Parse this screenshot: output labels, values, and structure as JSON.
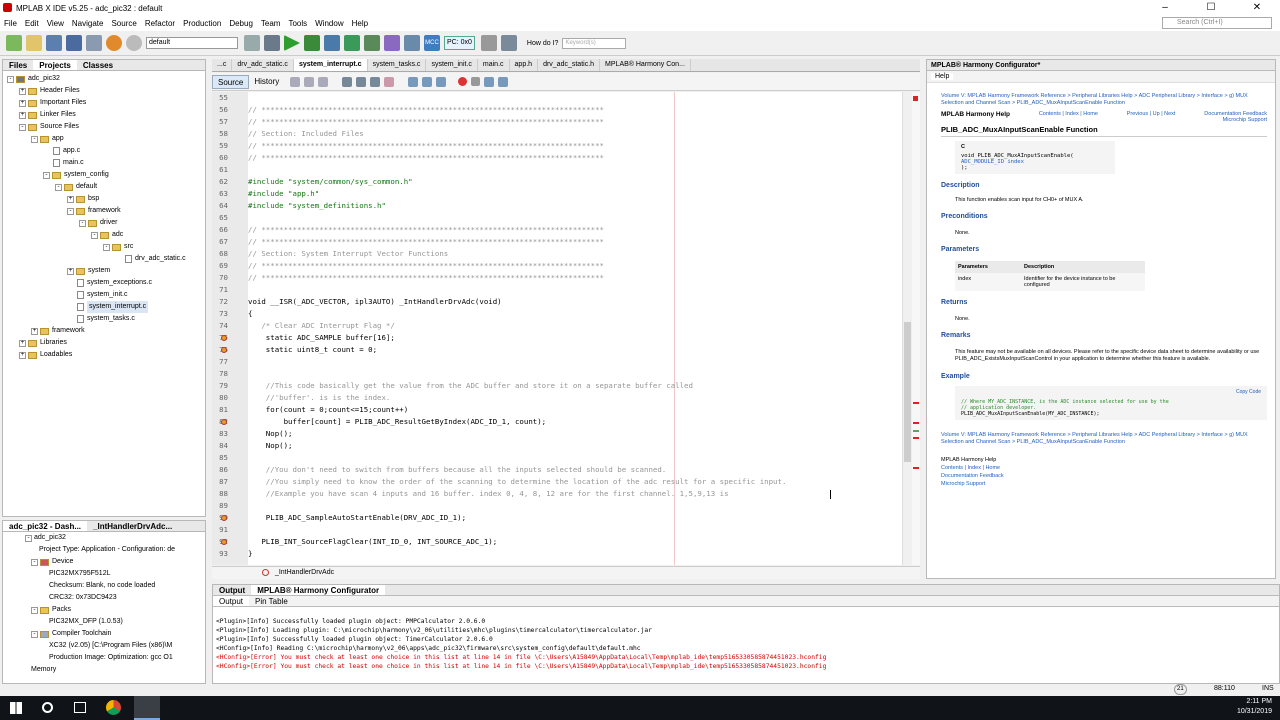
{
  "window": {
    "title": "MPLAB X IDE v5.25 - adc_pic32 : default",
    "minimize": "–",
    "maximize": "☐",
    "close": "✕"
  },
  "menu": [
    "File",
    "Edit",
    "View",
    "Navigate",
    "Source",
    "Refactor",
    "Production",
    "Debug",
    "Team",
    "Tools",
    "Window",
    "Help"
  ],
  "search_placeholder": "Search (Ctrl+I)",
  "toolbar": {
    "config": "default",
    "mcc": "MCC",
    "pc": "PC: 0x0",
    "how_do_i": "How do I?",
    "keywords": "Keyword(s)"
  },
  "projects_panel": {
    "tabs": [
      "Files",
      "Projects",
      "Classes"
    ],
    "items": [
      "adc_pic32",
      "Header Files",
      "Important Files",
      "Linker Files",
      "Source Files",
      "app",
      "app.c",
      "main.c",
      "system_config",
      "default",
      "bsp",
      "framework",
      "driver",
      "adc",
      "src",
      "drv_adc_static.c",
      "system",
      "system_exceptions.c",
      "system_init.c",
      "system_interrupt.c",
      "system_tasks.c",
      "framework",
      "Libraries",
      "Loadables"
    ]
  },
  "dashboard": {
    "tabs": [
      "adc_pic32 - Dash...",
      "_IntHandlerDrvAdc..."
    ],
    "items": [
      "adc_pic32",
      "Project Type: Application - Configuration: de",
      "Device",
      "PIC32MX795F512L",
      "Checksum: Blank, no code loaded",
      "CRC32: 0x73DC9423",
      "Packs",
      "PIC32MX_DFP (1.0.53)",
      "Compiler Toolchain",
      "XC32 (v2.05) [C:\\Program Files (x86)\\M",
      "Production Image: Optimization: gcc O1",
      "Memory"
    ]
  },
  "editor": {
    "tabs": [
      "...c",
      "drv_adc_static.c",
      "system_interrupt.c",
      "system_tasks.c",
      "system_init.c",
      "main.c",
      "app.h",
      "drv_adc_static.h",
      "MPLAB® Harmony Con..."
    ],
    "source_btn": "Source",
    "history_btn": "History",
    "lines": [
      {
        "n": "55",
        "t": ""
      },
      {
        "n": "56",
        "t": "// *****************************************************************************"
      },
      {
        "n": "57",
        "t": "// *****************************************************************************"
      },
      {
        "n": "58",
        "t": "// Section: Included Files"
      },
      {
        "n": "59",
        "t": "// *****************************************************************************"
      },
      {
        "n": "60",
        "t": "// *****************************************************************************"
      },
      {
        "n": "61",
        "t": ""
      },
      {
        "n": "62",
        "t": "#include \"system/common/sys_common.h\""
      },
      {
        "n": "63",
        "t": "#include \"app.h\""
      },
      {
        "n": "64",
        "t": "#include \"system_definitions.h\""
      },
      {
        "n": "65",
        "t": ""
      },
      {
        "n": "66",
        "t": "// *****************************************************************************"
      },
      {
        "n": "67",
        "t": "// *****************************************************************************"
      },
      {
        "n": "68",
        "t": "// Section: System Interrupt Vector Functions"
      },
      {
        "n": "69",
        "t": "// *****************************************************************************"
      },
      {
        "n": "70",
        "t": "// *****************************************************************************"
      },
      {
        "n": "71",
        "t": ""
      },
      {
        "n": "72",
        "t": "void __ISR(_ADC_VECTOR, ipl3AUTO) _IntHandlerDrvAdc(void)"
      },
      {
        "n": "73",
        "t": "{"
      },
      {
        "n": "74",
        "t": "   /* Clear ADC Interrupt Flag */"
      },
      {
        "n": "75",
        "t": "    static ADC_SAMPLE buffer[16];"
      },
      {
        "n": "76",
        "t": "    static uint8_t count = 0;"
      },
      {
        "n": "77",
        "t": ""
      },
      {
        "n": "78",
        "t": ""
      },
      {
        "n": "79",
        "t": "    //This code basically get the value from the ADC buffer and store it on a separate buffer called"
      },
      {
        "n": "80",
        "t": "    //'buffer'. is is the index."
      },
      {
        "n": "81",
        "t": "    for(count = 0;count<=15;count++)"
      },
      {
        "n": "82",
        "t": "        buffer[count] = PLIB_ADC_ResultGetByIndex(ADC_ID_1, count);"
      },
      {
        "n": "83",
        "t": "    Nop();"
      },
      {
        "n": "84",
        "t": "    Nop();"
      },
      {
        "n": "85",
        "t": ""
      },
      {
        "n": "86",
        "t": "    //You don't need to switch from buffers because all the inputs selected should be scanned."
      },
      {
        "n": "87",
        "t": "    //You simply need to know the order of the scanning to determine the location of the adc result for a specific input."
      },
      {
        "n": "88",
        "t": "    //Example you have scan 4 inputs and 16 buffer. index 0, 4, 8, 12 are for the first channel. 1,5,9,13 is"
      },
      {
        "n": "89",
        "t": ""
      },
      {
        "n": "90",
        "t": "    PLIB_ADC_SampleAutoStartEnable(DRV_ADC_ID_1);"
      },
      {
        "n": "91",
        "t": ""
      },
      {
        "n": "92",
        "t": "   PLIB_INT_SourceFlagClear(INT_ID_0, INT_SOURCE_ADC_1);"
      },
      {
        "n": "93",
        "t": "}"
      }
    ],
    "breadcrumb": "_IntHandlerDrvAdc"
  },
  "output": {
    "tabs": [
      "Output",
      "MPLAB® Harmony Configurator"
    ],
    "subtabs": [
      "Output",
      "Pin Table"
    ],
    "lines": [
      {
        "t": "<Plugin>[Info] Successfully loaded plugin object: PMPCalculator 2.0.6.0",
        "err": false
      },
      {
        "t": "<Plugin>[Info] Loading plugin: C:\\microchip\\harmony\\v2_06\\utilities\\mhc\\plugins\\timercalculator\\timercalculator.jar",
        "err": false
      },
      {
        "t": "<Plugin>[Info] Successfully loaded plugin object: TimerCalculator 2.0.6.0",
        "err": false
      },
      {
        "t": "<HConfig>[Info] Reading C:\\microchip\\harmony\\v2_06\\apps\\adc_pic32\\firmware\\src\\system_config\\default\\default.mhc",
        "err": false
      },
      {
        "t": "<HConfig>[Error] You must check at least one choice in this list at line 14 in file \\C:\\Users\\A15849\\AppData\\Local\\Temp\\mplab_ide\\temp5165330585874451023.hconfig",
        "err": true
      },
      {
        "t": "<HConfig>[Error] You must check at least one choice in this list at line 14 in file \\C:\\Users\\A15849\\AppData\\Local\\Temp\\mplab_ide\\temp5165330585874451023.hconfig",
        "err": true
      }
    ]
  },
  "help": {
    "tab_title": "MPLAB® Harmony Configurator*",
    "sub_tab": "Help",
    "breadcrumb": "Volume V: MPLAB Harmony Framework Reference > Peripheral Libraries Help > ADC Peripheral Library > Interface > g) MUX Selection and Channel Scan > PLIB_ADC_MuxAInputScanEnable Function",
    "nav_title": "MPLAB Harmony Help",
    "nav_links": "Contents | Index | Home",
    "nav_prev": "Previous | Up | Next",
    "feedback": "Documentation Feedback",
    "support": "Microchip Support",
    "func_title": "PLIB_ADC_MuxAInputScanEnable Function",
    "lang": "C",
    "signature_1": "void PLIB_ADC_MuxAInputScanEnable(",
    "signature_2": "    ADC_MODULE_ID index",
    "signature_3": ");",
    "desc_h": "Description",
    "desc": "This function enables scan input for CH0+ of MUX A.",
    "pre_h": "Preconditions",
    "pre": "None.",
    "params_h": "Parameters",
    "param_col1": "Parameters",
    "param_col2": "Description",
    "param_name": "index",
    "param_desc": "Identifier for the device instance to be configured",
    "ret_h": "Returns",
    "ret": "None.",
    "rem_h": "Remarks",
    "rem": "This feature may not be available on all devices. Please refer to the specific device data sheet to determine availability or use PLIB_ADC_ExistsMuxInputScanControl in your application to determine whether this feature is available.",
    "ex_h": "Example",
    "copy": "Copy Code",
    "ex1": "// Where MY_ADC_INSTANCE, is the ADC instance selected for use by the",
    "ex2": "// application developer.",
    "ex3": "PLIB_ADC_MuxAInputScanEnable(MY_ADC_INSTANCE);",
    "footer_title": "MPLAB Harmony Help",
    "footer_links": "Contents | Index | Home",
    "footer_fb": "Documentation Feedback",
    "footer_sup": "Microchip Support"
  },
  "status": {
    "position": "88:110",
    "mode": "INS",
    "notifications": "21"
  },
  "taskbar": {
    "time": "2:11 PM",
    "date": "10/31/2019"
  }
}
